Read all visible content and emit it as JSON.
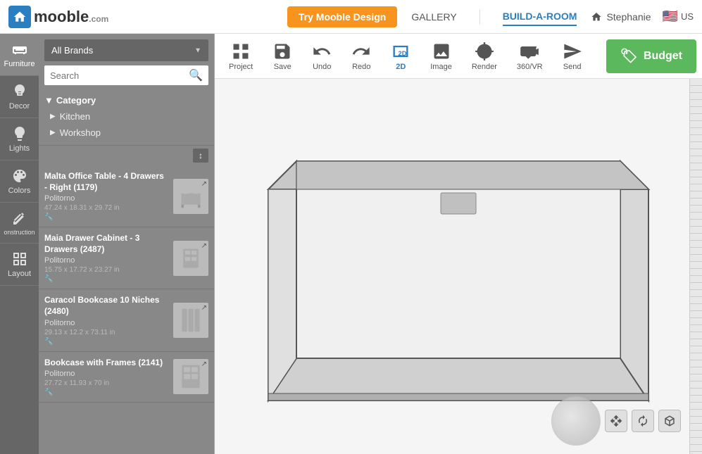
{
  "nav": {
    "logo_text": "mooble",
    "logo_com": ".com",
    "try_btn": "Try Mooble Design",
    "gallery": "GALLERY",
    "build_a_room": "BUILD-A-ROOM",
    "user": "Stephanie",
    "flag": "🇺🇸",
    "us": "US"
  },
  "sidebar": {
    "items": [
      {
        "label": "Furniture",
        "icon": "sofa"
      },
      {
        "label": "Decor",
        "icon": "vase"
      },
      {
        "label": "Lights",
        "icon": "lightbulb"
      },
      {
        "label": "Colors",
        "icon": "palette"
      },
      {
        "label": "onstruction",
        "icon": "construction"
      },
      {
        "label": "Layout",
        "icon": "layout"
      }
    ]
  },
  "panel": {
    "brand_placeholder": "All Brands",
    "search_placeholder": "Search",
    "category_label": "Category",
    "category_items": [
      {
        "label": "Kitchen"
      },
      {
        "label": "Workshop"
      }
    ],
    "sort_label": "↕",
    "products": [
      {
        "name": "Malta Office Table - 4 Drawers - Right (1179)",
        "brand": "Politorno",
        "dims": "47.24 x 18.31 x 29.72 in",
        "add": "+"
      },
      {
        "name": "Maia Drawer Cabinet - 3 Drawers (2487)",
        "brand": "Politorno",
        "dims": "15.75 x 17.72 x 23.27 in",
        "add": "+"
      },
      {
        "name": "Caracol Bookcase 10 Niches (2480)",
        "brand": "Politorno",
        "dims": "29.13 x 12.2 x 73.11 in",
        "add": "+"
      },
      {
        "name": "Bookcase with Frames (2141)",
        "brand": "Politorno",
        "dims": "27.72 x 11.93 x 70 in",
        "add": "+"
      }
    ]
  },
  "toolbar": {
    "buttons": [
      {
        "label": "Project",
        "icon": "project"
      },
      {
        "label": "Save",
        "icon": "save"
      },
      {
        "label": "Undo",
        "icon": "undo"
      },
      {
        "label": "Redo",
        "icon": "redo"
      },
      {
        "label": "2D",
        "icon": "2d"
      },
      {
        "label": "Image",
        "icon": "image"
      },
      {
        "label": "Render",
        "icon": "render"
      },
      {
        "label": "360/VR",
        "icon": "vr"
      },
      {
        "label": "Send",
        "icon": "send"
      }
    ],
    "budget_label": "Budget",
    "budget_icon": "🏷"
  },
  "colors": {
    "accent": "#f7941d",
    "nav_active": "#2b7fc1",
    "budget_green": "#5cb85c",
    "sidebar_bg": "#666666",
    "panel_bg": "#888888"
  }
}
